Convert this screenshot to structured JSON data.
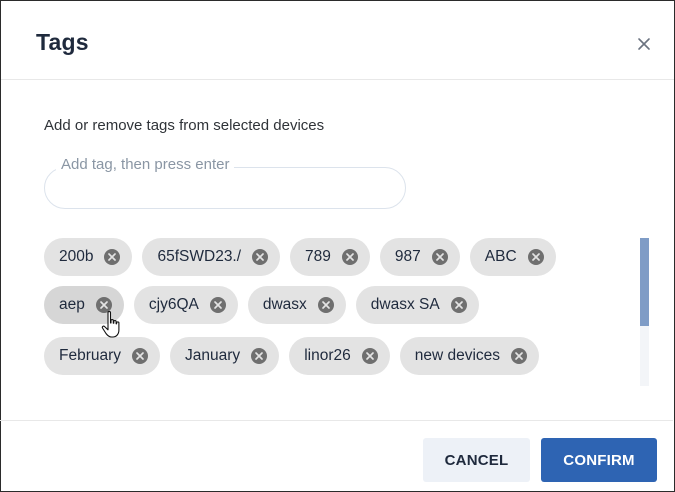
{
  "dialog": {
    "title": "Tags",
    "subtitle": "Add or remove tags from selected devices"
  },
  "tag_input": {
    "label": "Add tag, then press enter",
    "value": ""
  },
  "tags": [
    [
      "200b",
      "65fSWD23./",
      "789",
      "987",
      "ABC"
    ],
    [
      "aep",
      "cjy6QA",
      "dwasx",
      "dwasx SA"
    ],
    [
      "February",
      "January",
      "linor26",
      "new devices"
    ]
  ],
  "hovered_tag": "aep",
  "buttons": {
    "cancel": "CANCEL",
    "confirm": "CONFIRM"
  },
  "colors": {
    "title": "#1f2a3d",
    "chip_bg": "#e3e3e3",
    "chip_remove_icon": "#6f6f6f",
    "confirm_bg": "#2e64b3",
    "cancel_bg": "#edf1f7",
    "scrollbar_thumb": "#7f9cc6"
  },
  "icons": {
    "close": "close-icon",
    "chip_remove": "x-circle-icon",
    "cursor": "hand-pointer-icon"
  }
}
